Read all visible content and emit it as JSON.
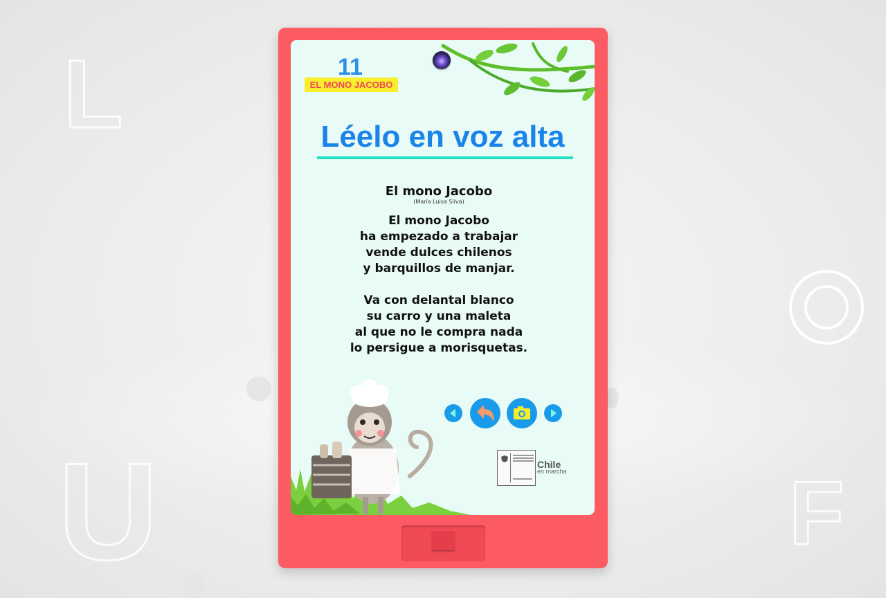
{
  "background": {
    "letters": [
      "L",
      "U",
      "F"
    ],
    "color": "#e9e9e9"
  },
  "device": {
    "frame_color": "#fd5b63",
    "screen_color": "#e9fbf6"
  },
  "page": {
    "number": "11",
    "section_label": "EL MONO JACOBO"
  },
  "heading": {
    "text": "Léelo en voz alta",
    "color": "#1b84e8",
    "underline_color": "#1fe0c0"
  },
  "poem": {
    "title": "El mono Jacobo",
    "author": "(María Luisa Silva)",
    "stanzas": [
      [
        "El mono Jacobo",
        "ha empezado a trabajar",
        "vende dulces chilenos",
        "y barquillos de manjar."
      ],
      [
        "Va con delantal blanco",
        "su carro y una maleta",
        "al que no le compra nada",
        "lo persigue a morisquetas."
      ]
    ]
  },
  "controls": {
    "prev": "previous-arrow-icon",
    "back": "back-arrow-icon",
    "camera": "camera-icon",
    "next": "next-arrow-icon",
    "button_color": "#1a9be9"
  },
  "footer": {
    "brand": "Chile",
    "brand_sub": "en marcha"
  }
}
